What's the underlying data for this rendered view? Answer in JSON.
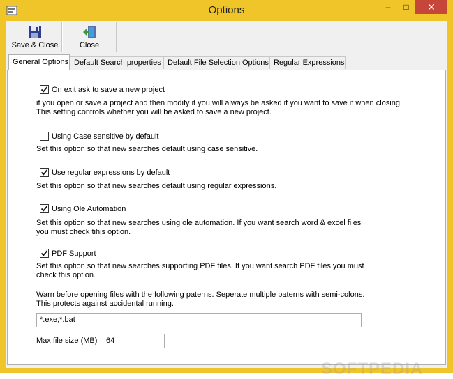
{
  "window": {
    "title": "Options",
    "close_glyph": "✕",
    "minimize_glyph": "–",
    "maximize_glyph": "□"
  },
  "toolbar": {
    "save_close_label": "Save & Close",
    "save_close_icon": "floppy-disk-icon",
    "close_label": "Close",
    "close_icon": "exit-door-icon"
  },
  "tabs": [
    {
      "label": "General Options",
      "active": true
    },
    {
      "label": "Default Search properties",
      "active": false
    },
    {
      "label": "Default File Selection Options",
      "active": false
    },
    {
      "label": "Regular Expressions",
      "active": false
    }
  ],
  "general": {
    "options": [
      {
        "label": "On exit ask to save a new project",
        "checked": true,
        "description": "if you open or save a project and then modify it you will always be asked if you want to save it when closing. This setting controls whether you will be asked to save a new project."
      },
      {
        "label": "Using Case sensitive by default",
        "checked": false,
        "description": "Set this option so that new searches default using case sensitive."
      },
      {
        "label": "Use regular expressions by default",
        "checked": true,
        "description": "Set this option so that new searches default using regular expressions."
      },
      {
        "label": "Using Ole Automation",
        "checked": true,
        "description": "Set this option so that new searches using ole automation. If you want search word & excel files you must check tihis option."
      },
      {
        "label": "PDF Support",
        "checked": true,
        "description": "Set this option so that new searches supporting PDF files. If you want search PDF files you must check this option."
      }
    ],
    "warn_text": "Warn before opening files with the following paterns. Seperate multiple paterns with semi-colons. This protects against accidental running.",
    "patterns_value": "*.exe;*.bat",
    "max_file_size_label": "Max file size (MB)",
    "max_file_size_value": "64"
  },
  "watermark": "SOFTPEDIA",
  "colors": {
    "titlebar": "#f0c52a",
    "close_button": "#c7463a"
  }
}
